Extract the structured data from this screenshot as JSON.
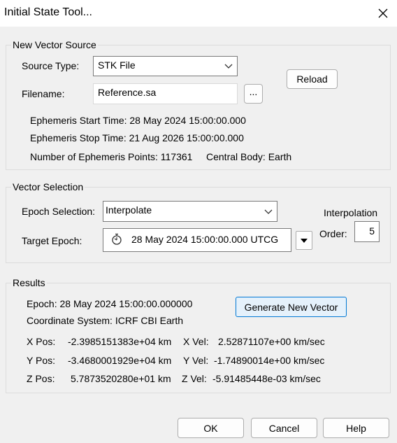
{
  "window": {
    "title": "Initial State Tool..."
  },
  "new_vector_source": {
    "legend": "New Vector Source",
    "source_type_label": "Source Type:",
    "source_type_value": "STK File",
    "filename_label": "Filename:",
    "filename_value": "Reference.sa",
    "browse_label": "...",
    "reload_label": "Reload",
    "start_time": "Ephemeris Start Time: 28 May 2024 15:00:00.000",
    "stop_time": "Ephemeris Stop Time: 21 Aug 2026 15:00:00.000",
    "num_points": "Number of Ephemeris Points: 117361",
    "central_body": "Central Body: Earth"
  },
  "vector_selection": {
    "legend": "Vector Selection",
    "epoch_selection_label": "Epoch Selection:",
    "epoch_selection_value": "Interpolate",
    "target_epoch_label": "Target Epoch:",
    "target_epoch_value": "28 May 2024 15:00:00.000 UTCG",
    "interp_label_1": "Interpolation",
    "interp_label_2": "Order:",
    "interp_order": "5"
  },
  "results": {
    "legend": "Results",
    "epoch": "Epoch: 28 May 2024 15:00:00.000000",
    "coord_system": "Coordinate System: ICRF CBI  Earth",
    "generate_label": "Generate New Vector",
    "x_pos_label": "X Pos:",
    "x_pos": "-2.3985151383e+04 km",
    "y_pos_label": "Y Pos:",
    "y_pos": "-3.4680001929e+04 km",
    "z_pos_label": "Z Pos:",
    "z_pos": "5.7873520280e+01 km",
    "x_vel_label": "X Vel:",
    "x_vel": "2.52871107e+00 km/sec",
    "y_vel_label": "Y Vel:",
    "y_vel": "-1.74890014e+00 km/sec",
    "z_vel_label": "Z Vel:",
    "z_vel": "-5.91485448e-03 km/sec"
  },
  "footer": {
    "ok_label": "OK",
    "cancel_label": "Cancel",
    "help_label": "Help"
  },
  "colors": {
    "accent": "#0078d4",
    "generate_bg": "#e5f1fb"
  }
}
